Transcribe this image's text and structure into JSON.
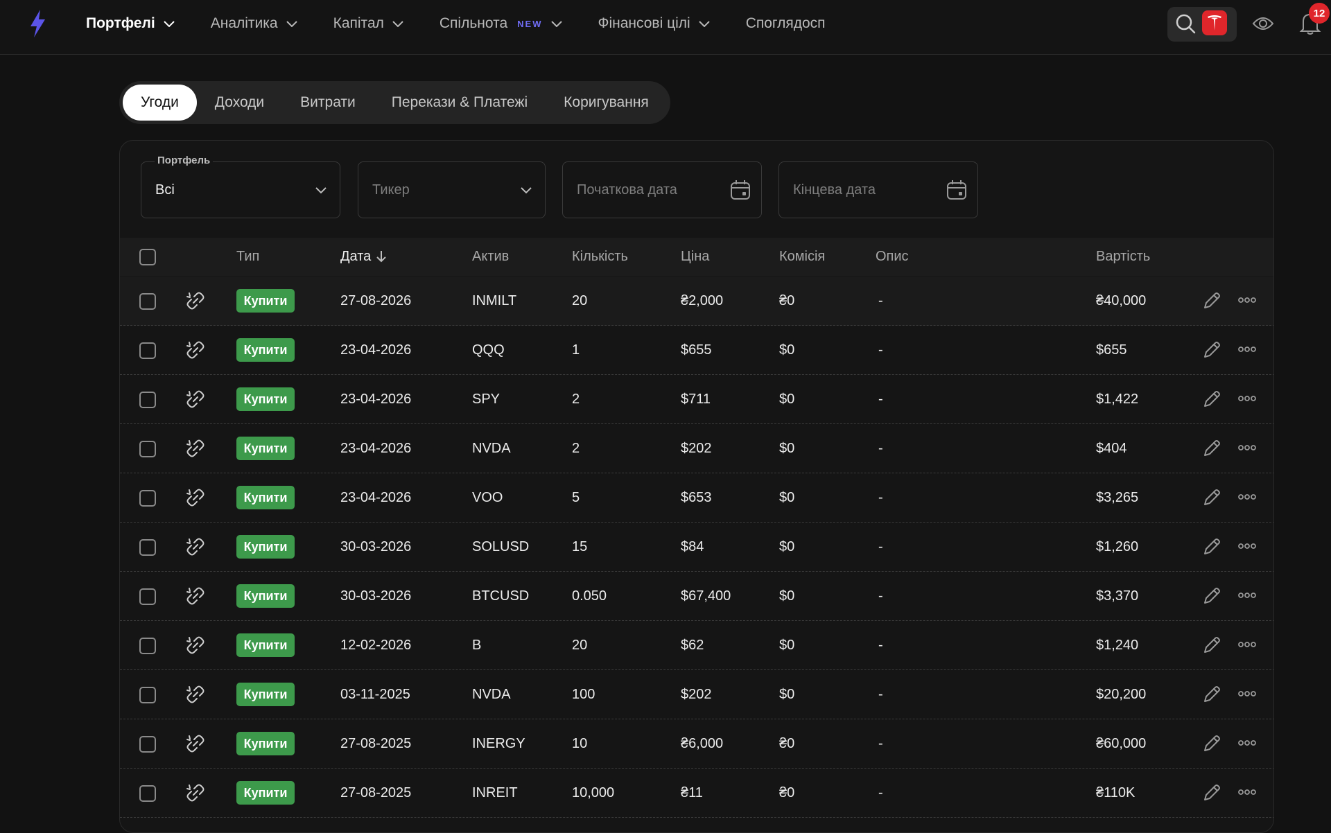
{
  "nav": {
    "items": [
      {
        "label": "Портфелі",
        "active": true,
        "chevron": true,
        "badge": ""
      },
      {
        "label": "Аналітика",
        "active": false,
        "chevron": true,
        "badge": ""
      },
      {
        "label": "Капітал",
        "active": false,
        "chevron": true,
        "badge": ""
      },
      {
        "label": "Спільнота",
        "active": false,
        "chevron": true,
        "badge": "NEW"
      },
      {
        "label": "Фінансові цілі",
        "active": false,
        "chevron": true,
        "badge": ""
      },
      {
        "label": "Споглядосп",
        "active": false,
        "chevron": false,
        "badge": ""
      }
    ],
    "notifications_count": "12",
    "accent_color": "#6f6cf3"
  },
  "tabs": [
    "Угоди",
    "Доходи",
    "Витрати",
    "Перекази & Платежі",
    "Коригування"
  ],
  "active_tab": 0,
  "filters": {
    "portfolio_label": "Портфель",
    "portfolio_value": "Всі",
    "ticker_placeholder": "Тикер",
    "start_date_placeholder": "Початкова дата",
    "end_date_placeholder": "Кінцева дата"
  },
  "table": {
    "headers": {
      "type": "Тип",
      "date": "Дата",
      "asset": "Актив",
      "quantity": "Кількість",
      "price": "Ціна",
      "commission": "Комісія",
      "description": "Опис",
      "value": "Вартість"
    },
    "sorted_by": "date",
    "buy_color": "#3d9a4b",
    "rows": [
      {
        "type": "Купити",
        "date": "27-08-2026",
        "asset": "INMILT",
        "quantity": "20",
        "price": "₴2,000",
        "commission": "₴0",
        "description": "-",
        "value": "₴40,000"
      },
      {
        "type": "Купити",
        "date": "23-04-2026",
        "asset": "QQQ",
        "quantity": "1",
        "price": "$655",
        "commission": "$0",
        "description": "-",
        "value": "$655"
      },
      {
        "type": "Купити",
        "date": "23-04-2026",
        "asset": "SPY",
        "quantity": "2",
        "price": "$711",
        "commission": "$0",
        "description": "-",
        "value": "$1,422"
      },
      {
        "type": "Купити",
        "date": "23-04-2026",
        "asset": "NVDA",
        "quantity": "2",
        "price": "$202",
        "commission": "$0",
        "description": "-",
        "value": "$404"
      },
      {
        "type": "Купити",
        "date": "23-04-2026",
        "asset": "VOO",
        "quantity": "5",
        "price": "$653",
        "commission": "$0",
        "description": "-",
        "value": "$3,265"
      },
      {
        "type": "Купити",
        "date": "30-03-2026",
        "asset": "SOLUSD",
        "quantity": "15",
        "price": "$84",
        "commission": "$0",
        "description": "-",
        "value": "$1,260"
      },
      {
        "type": "Купити",
        "date": "30-03-2026",
        "asset": "BTCUSD",
        "quantity": "0.050",
        "price": "$67,400",
        "commission": "$0",
        "description": "-",
        "value": "$3,370"
      },
      {
        "type": "Купити",
        "date": "12-02-2026",
        "asset": "B",
        "quantity": "20",
        "price": "$62",
        "commission": "$0",
        "description": "-",
        "value": "$1,240"
      },
      {
        "type": "Купити",
        "date": "03-11-2025",
        "asset": "NVDA",
        "quantity": "100",
        "price": "$202",
        "commission": "$0",
        "description": "-",
        "value": "$20,200"
      },
      {
        "type": "Купити",
        "date": "27-08-2025",
        "asset": "INERGY",
        "quantity": "10",
        "price": "₴6,000",
        "commission": "₴0",
        "description": "-",
        "value": "₴60,000"
      },
      {
        "type": "Купити",
        "date": "27-08-2025",
        "asset": "INREIT",
        "quantity": "10,000",
        "price": "₴11",
        "commission": "₴0",
        "description": "-",
        "value": "₴110K"
      }
    ]
  }
}
